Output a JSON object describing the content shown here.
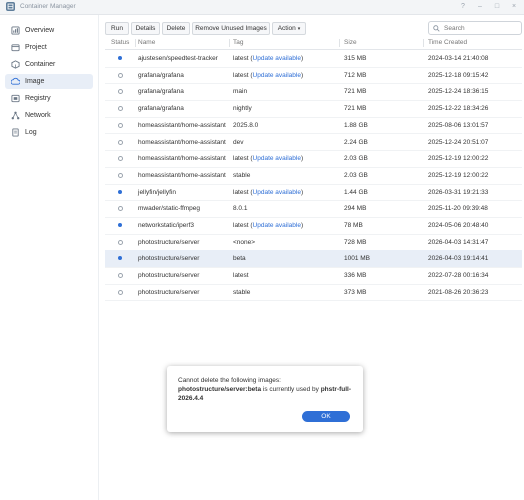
{
  "window": {
    "title": "Container Manager"
  },
  "sidebar": {
    "items": [
      {
        "label": "Overview",
        "icon": "overview-icon"
      },
      {
        "label": "Project",
        "icon": "project-icon"
      },
      {
        "label": "Container",
        "icon": "container-icon"
      },
      {
        "label": "Image",
        "icon": "image-icon",
        "active": true
      },
      {
        "label": "Registry",
        "icon": "registry-icon"
      },
      {
        "label": "Network",
        "icon": "network-icon"
      },
      {
        "label": "Log",
        "icon": "log-icon"
      }
    ]
  },
  "toolbar": {
    "run": "Run",
    "details": "Details",
    "delete": "Delete",
    "remove_unused": "Remove Unused Images",
    "action": "Action",
    "search_placeholder": "Search"
  },
  "table": {
    "columns": {
      "status": "Status",
      "name": "Name",
      "tag": "Tag",
      "size": "Size",
      "time": "Time Created"
    },
    "rows": [
      {
        "status": "running",
        "name": "ajustesen/speedtest-tracker",
        "tag": "latest",
        "update": "Update available",
        "size": "315 MB",
        "time": "2024-03-14 21:40:08"
      },
      {
        "status": "stopped",
        "name": "grafana/grafana",
        "tag": "latest",
        "update": "Update available",
        "size": "712 MB",
        "time": "2025-12-18 09:15:42"
      },
      {
        "status": "stopped",
        "name": "grafana/grafana",
        "tag": "main",
        "update": "",
        "size": "721 MB",
        "time": "2025-12-24 18:36:15"
      },
      {
        "status": "stopped",
        "name": "grafana/grafana",
        "tag": "nightly",
        "update": "",
        "size": "721 MB",
        "time": "2025-12-22 18:34:26"
      },
      {
        "status": "stopped",
        "name": "homeassistant/home-assistant",
        "tag": "2025.8.0",
        "update": "",
        "size": "1.88 GB",
        "time": "2025-08-06 13:01:57"
      },
      {
        "status": "stopped",
        "name": "homeassistant/home-assistant",
        "tag": "dev",
        "update": "",
        "size": "2.24 GB",
        "time": "2025-12-24 20:51:07"
      },
      {
        "status": "stopped",
        "name": "homeassistant/home-assistant",
        "tag": "latest",
        "update": "Update available",
        "size": "2.03 GB",
        "time": "2025-12-19 12:00:22"
      },
      {
        "status": "stopped",
        "name": "homeassistant/home-assistant",
        "tag": "stable",
        "update": "",
        "size": "2.03 GB",
        "time": "2025-12-19 12:00:22"
      },
      {
        "status": "running",
        "name": "jellyfin/jellyfin",
        "tag": "latest",
        "update": "Update available",
        "size": "1.44 GB",
        "time": "2026-03-31 19:21:33"
      },
      {
        "status": "stopped",
        "name": "mwader/static-ffmpeg",
        "tag": "8.0.1",
        "update": "",
        "size": "294 MB",
        "time": "2025-11-20 09:39:48"
      },
      {
        "status": "running",
        "name": "networkstatic/iperf3",
        "tag": "latest",
        "update": "Update available",
        "size": "78 MB",
        "time": "2024-05-06 20:48:40"
      },
      {
        "status": "stopped",
        "name": "photostructure/server",
        "tag": "<none>",
        "update": "",
        "size": "728 MB",
        "time": "2026-04-03 14:31:47"
      },
      {
        "status": "running",
        "name": "photostructure/server",
        "tag": "beta",
        "update": "",
        "size": "1001 MB",
        "time": "2026-04-03 19:14:41",
        "selected": true
      },
      {
        "status": "stopped",
        "name": "photostructure/server",
        "tag": "latest",
        "update": "",
        "size": "336 MB",
        "time": "2022-07-28 00:16:34"
      },
      {
        "status": "stopped",
        "name": "photostructure/server",
        "tag": "stable",
        "update": "",
        "size": "373 MB",
        "time": "2021-08-26 20:36:23"
      }
    ]
  },
  "dialog": {
    "line1": "Cannot delete the following images:",
    "image_ref": "photostructure/server:beta",
    "middle": " is currently used by ",
    "container_ref": "phstr-full-2026.4.4",
    "ok": "OK"
  },
  "colors": {
    "accent": "#2f6fd6",
    "selected_row": "#e8eef7"
  }
}
